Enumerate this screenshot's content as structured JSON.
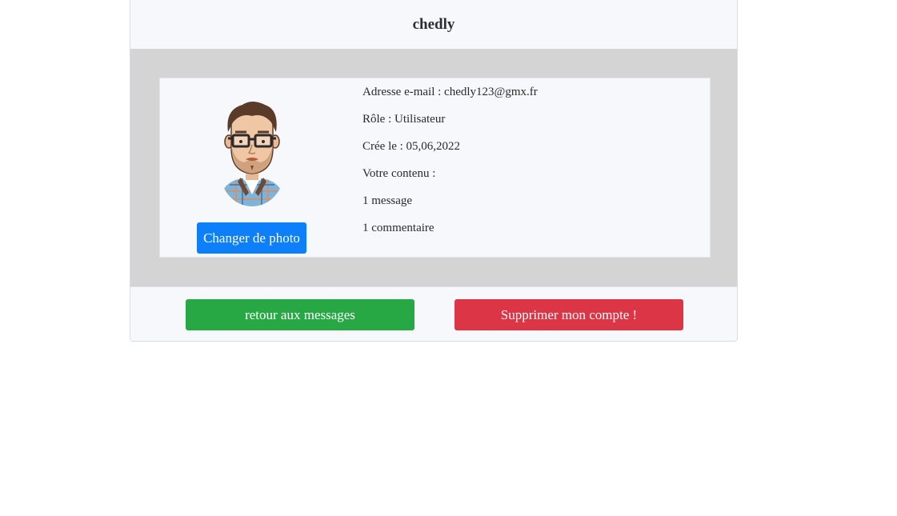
{
  "profile": {
    "username": "chedly",
    "avatar_icon": "avatar-man-glasses-beard-icon",
    "change_photo_label": "Changer de photo",
    "email_line": "Adresse e-mail : chedly123@gmx.fr",
    "role_line": "Rôle : Utilisateur",
    "created_line": "Crée le : 05,06,2022",
    "content_heading": "Votre contenu :",
    "messages_count": "1 message",
    "comments_count": "1 commentaire"
  },
  "actions": {
    "back_label": "retour aux messages",
    "delete_label": "Supprimer mon compte !"
  },
  "colors": {
    "primary": "#0d7ffb",
    "success": "#28a745",
    "danger": "#dc3545",
    "panel_bg": "#d4d4d4",
    "card_bg": "#f7f8fc"
  }
}
